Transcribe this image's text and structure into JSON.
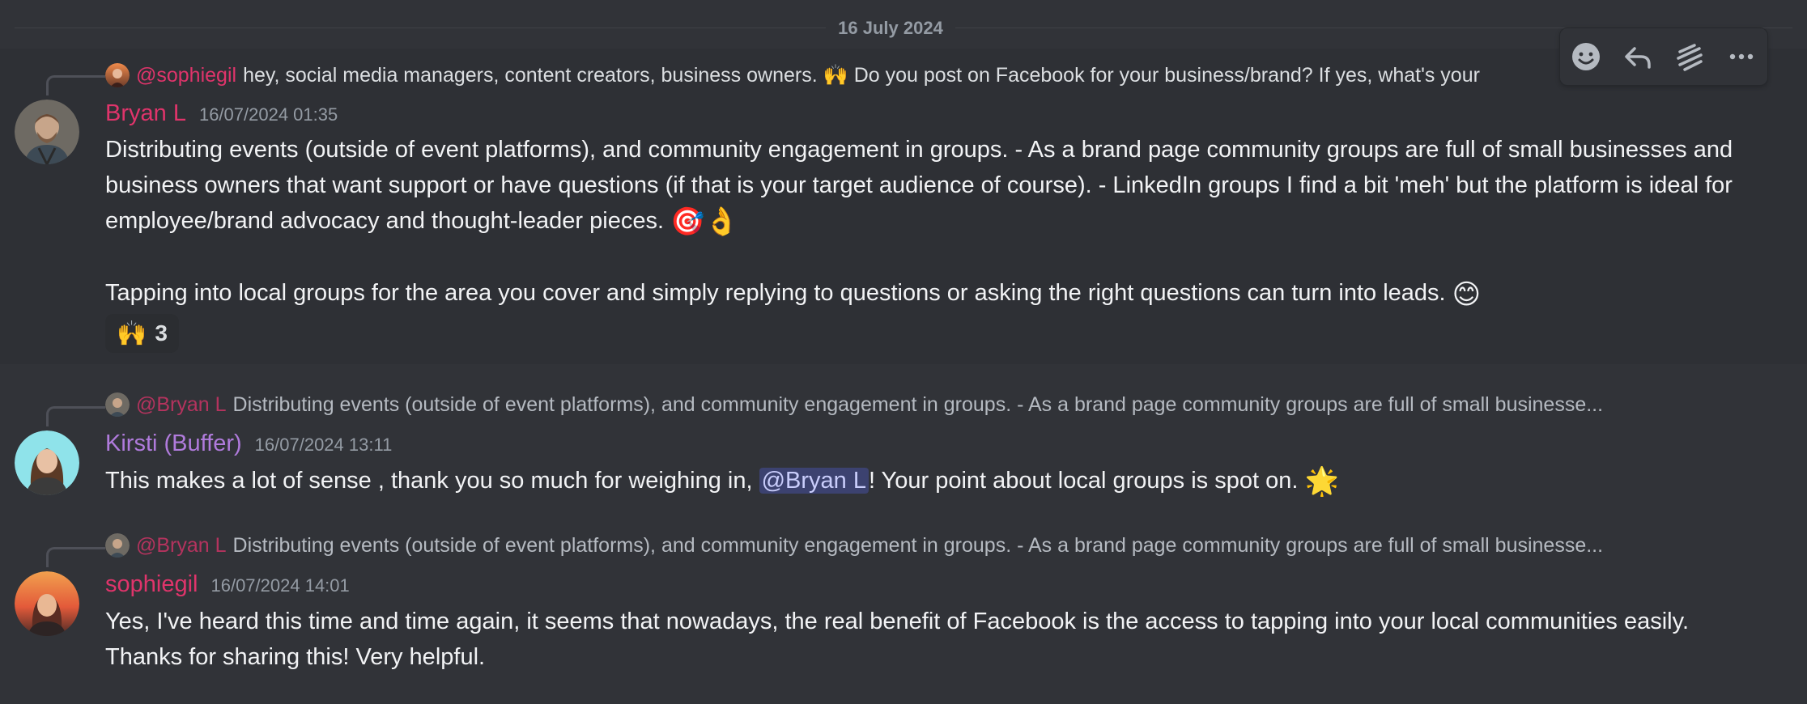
{
  "date_divider": "16 July 2024",
  "messages": [
    {
      "reply": {
        "name": "@sophiegil",
        "text": "hey, social media managers, content creators, business owners. 🙌 Do you post on Facebook for your business/brand? If yes, what's your"
      },
      "author": "Bryan L",
      "author_color": "#e0346b",
      "timestamp": "16/07/2024 01:35",
      "paragraph1": "Distributing events (outside of event platforms), and community engagement in groups. - As a brand page community groups are full of small businesses and business owners that want support or have questions (if that is your target audience of course). - LinkedIn groups I find a bit 'meh' but the platform is ideal for employee/brand advocacy and thought-leader pieces.",
      "paragraph1_emoji": "🎯👌",
      "paragraph2": "Tapping into local groups for the area you cover and simply replying to questions or asking the right questions can turn into leads.",
      "paragraph2_emoji": "😊",
      "reaction": {
        "emoji": "🙌",
        "count": "3"
      }
    },
    {
      "reply": {
        "name": "@Bryan L",
        "text": "Distributing events (outside of event platforms), and community engagement in groups. - As a brand page community groups are full of small businesse..."
      },
      "author": "Kirsti (Buffer)",
      "author_color": "#b07bdc",
      "timestamp": "16/07/2024 13:11",
      "text_before": "This makes a lot of sense , thank you so much for weighing in, ",
      "mention": "@Bryan L",
      "text_after": "! Your point about local groups is spot on.",
      "emoji": "🌟"
    },
    {
      "reply": {
        "name": "@Bryan L",
        "text": "Distributing events (outside of event platforms), and community engagement in groups. - As a brand page community groups are full of small businesse..."
      },
      "author": "sophiegil",
      "author_color": "#e0346b",
      "timestamp": "16/07/2024 14:01",
      "text": "Yes, I've heard this time and time again, it seems that nowadays, the real benefit of Facebook is the access to tapping into your local communities easily. Thanks for sharing this! Very helpful."
    }
  ],
  "toolbar": {
    "icons": [
      "add-reaction-icon",
      "reply-icon",
      "create-thread-icon",
      "more-options-icon"
    ]
  }
}
